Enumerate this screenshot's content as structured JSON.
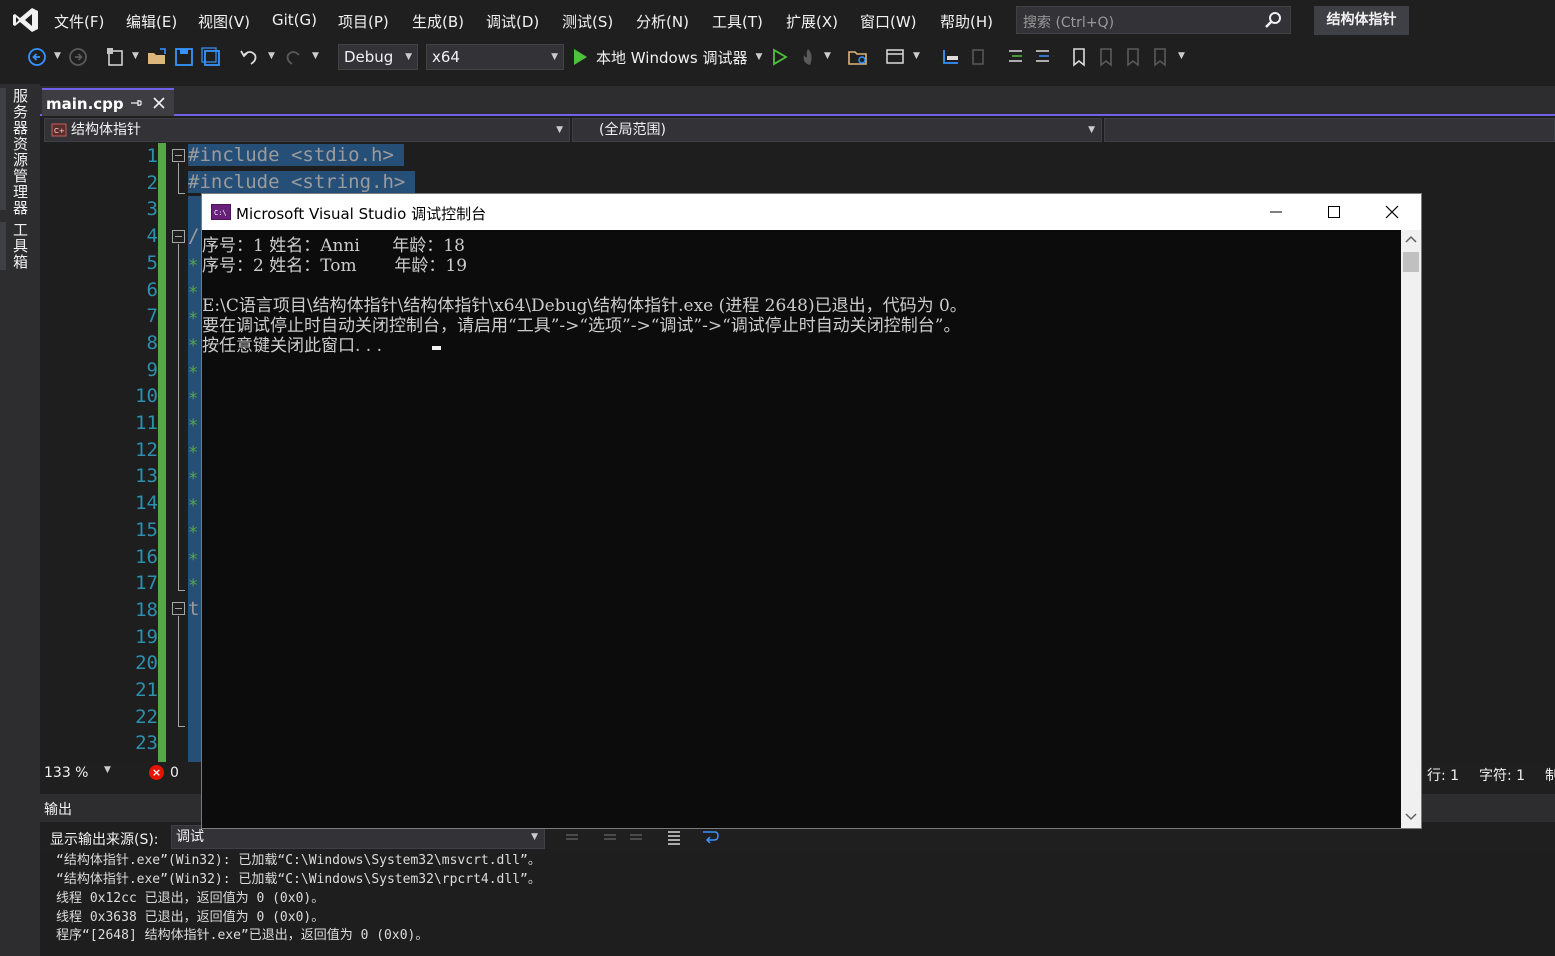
{
  "menu": {
    "items": [
      "文件(F)",
      "编辑(E)",
      "视图(V)",
      "Git(G)",
      "项目(P)",
      "生成(B)",
      "调试(D)",
      "测试(S)",
      "分析(N)",
      "工具(T)",
      "扩展(X)",
      "窗口(W)",
      "帮助(H)"
    ],
    "search_placeholder": "搜索 (Ctrl+Q)",
    "solution_name": "结构体指针"
  },
  "toolbar": {
    "config": "Debug",
    "platform": "x64",
    "run_label": "本地 Windows 调试器"
  },
  "side_tabs": [
    "服务器资源管理器",
    "工具箱"
  ],
  "editor": {
    "tab_title": "main.cpp",
    "nav_project": "结构体指针",
    "nav_scope": "(全局范围)",
    "line_numbers": [
      "1",
      "2",
      "3",
      "4",
      "5",
      "6",
      "7",
      "8",
      "9",
      "10",
      "11",
      "12",
      "13",
      "14",
      "15",
      "16",
      "17",
      "18",
      "19",
      "20",
      "21",
      "22",
      "23"
    ],
    "code_lines": [
      "#include <stdio.h>",
      "#include <string.h>"
    ],
    "partial_chars": [
      "/",
      "t"
    ]
  },
  "status": {
    "zoom": "133 %",
    "errors": "0",
    "row": "行: 1",
    "col": "字符: 1",
    "char": "制"
  },
  "output": {
    "title": "输出",
    "source_label": "显示输出来源(S):",
    "source_value": "调试",
    "lines": [
      "“结构体指针.exe”(Win32): 已加载“C:\\Windows\\System32\\msvcrt.dll”。",
      "“结构体指针.exe”(Win32): 已加载“C:\\Windows\\System32\\rpcrt4.dll”。",
      "线程 0x12cc 已退出，返回值为 0 (0x0)。",
      "线程 0x3638 已退出，返回值为 0 (0x0)。",
      "程序“[2648] 结构体指针.exe”已退出，返回值为 0 (0x0)。"
    ]
  },
  "console": {
    "title": "Microsoft Visual Studio 调试控制台",
    "lines": [
      "序号：1 姓名：Anni      年龄：18",
      "序号：2 姓名：Tom       年龄：19",
      "",
      "E:\\C语言项目\\结构体指针\\结构体指针\\x64\\Debug\\结构体指针.exe (进程 2648)已退出，代码为 0。",
      "要在调试停止时自动关闭控制台，请启用“工具”->“选项”->“调试”->“调试停止时自动关闭控制台”。",
      "按任意键关闭此窗口. . ."
    ]
  },
  "colors": {
    "accent": "#7160e8",
    "line_number": "#2b91af",
    "change_bar": "#57a64a",
    "selection": "#264f78",
    "error": "#e51400"
  }
}
